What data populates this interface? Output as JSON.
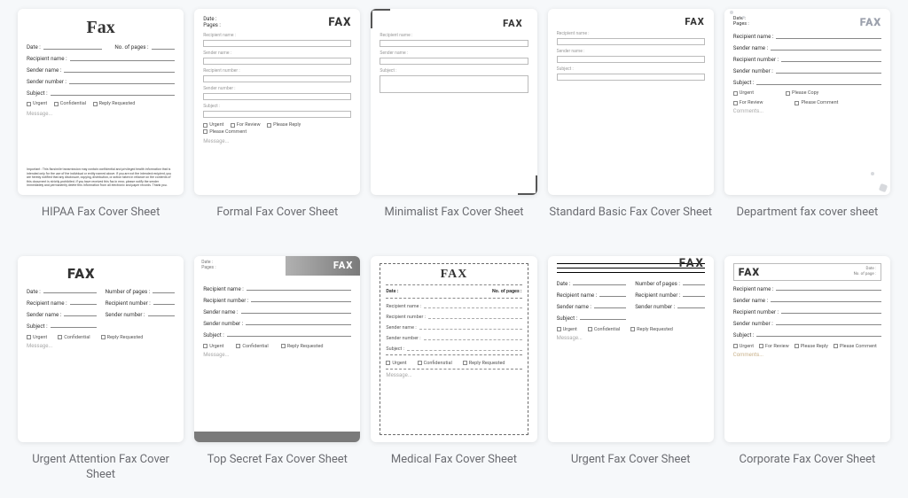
{
  "labels": {
    "date": "Date :",
    "pages": "Pages :",
    "no_of_pages": "No. of pages :",
    "no_of_page": "No. of page :",
    "number_of_pages": "Number of pages :",
    "recipient_name": "Recipient name :",
    "recipient_number": "Recipient number :",
    "sender_name": "Sender name :",
    "sender_number": "Sender number :",
    "subject": "Subject :",
    "message": "Message...",
    "comments": "Comments...",
    "fax_upper": "FAX",
    "fax_serif": "Fax",
    "urgent": "Urgent",
    "confidential": "Confidential",
    "confidential2": "Confidenstial",
    "reply_requested": "Reply Requested",
    "for_review": "For Review",
    "please_reply": "Please Reply",
    "please_comment": "Please Comment",
    "please_copy": "Please Copy",
    "hipaa_important": "Important : This facsimile transmission may contain confidential and privileged health information that is intended only for the use of the individual or entity named above. If you are not the intended recipient, you are hereby notified that any disclosure, copying, distribution, or action taken in reliance on the contents of this document is strictly prohibited. If you have received this fax in error, please notify the sender immediately and permanently delete this information from all electronic and paper records. Thank you."
  },
  "templates": [
    {
      "title": "HIPAA Fax Cover Sheet"
    },
    {
      "title": "Formal Fax Cover Sheet"
    },
    {
      "title": "Minimalist Fax Cover Sheet"
    },
    {
      "title": "Standard Basic Fax Cover Sheet"
    },
    {
      "title": "Department fax cover sheet"
    },
    {
      "title": "Urgent Attention Fax Cover Sheet"
    },
    {
      "title": "Top Secret Fax Cover Sheet"
    },
    {
      "title": "Medical Fax Cover Sheet"
    },
    {
      "title": "Urgent Fax Cover Sheet"
    },
    {
      "title": "Corporate Fax Cover Sheet"
    }
  ]
}
